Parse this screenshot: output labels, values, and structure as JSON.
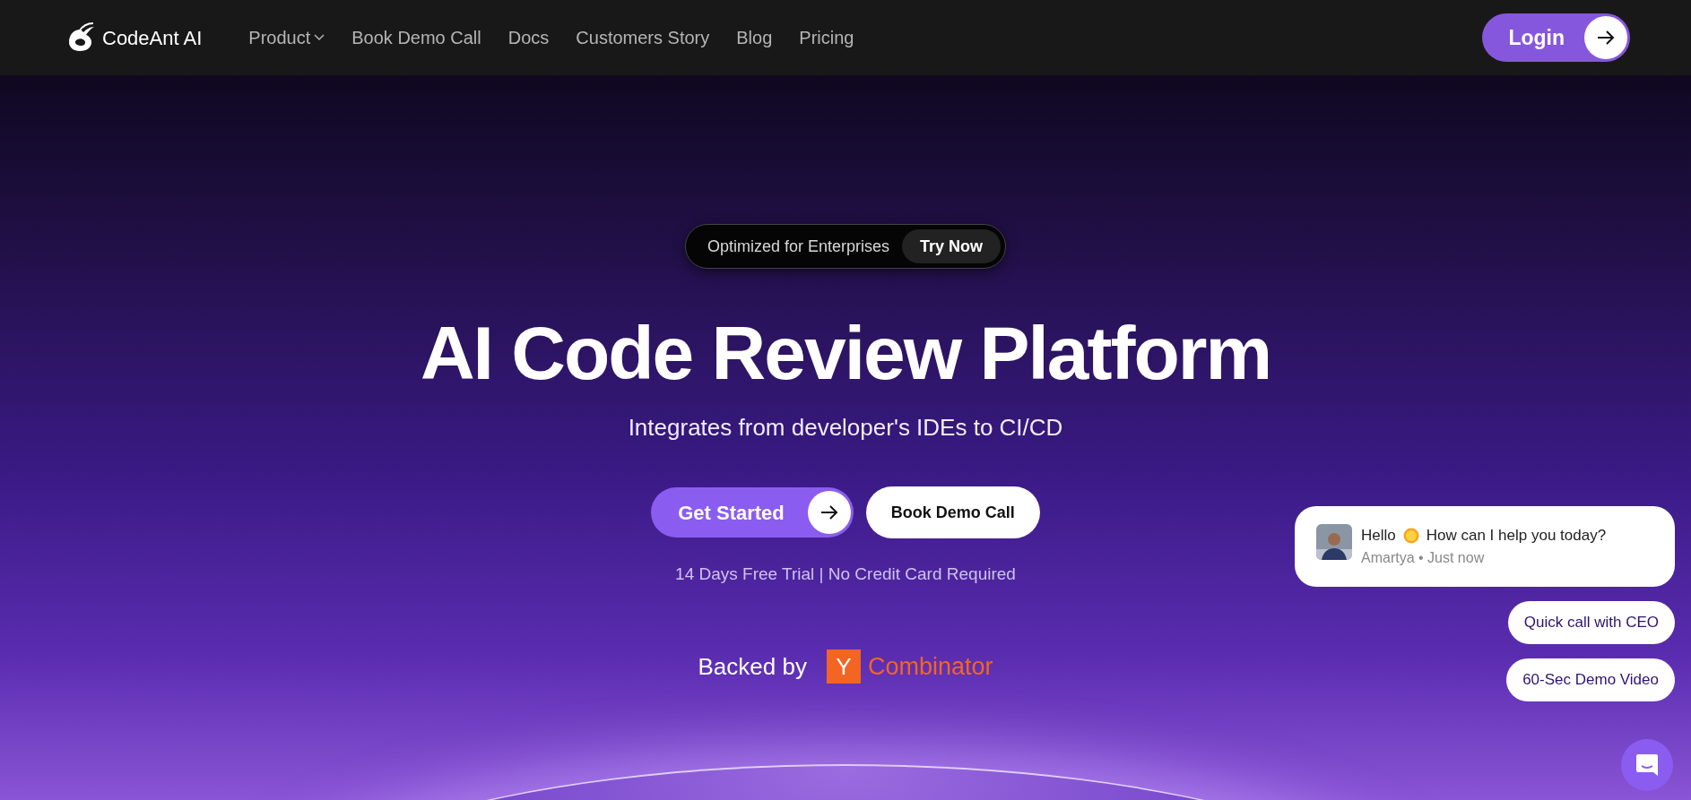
{
  "nav": {
    "brand": "CodeAnt AI",
    "links": [
      {
        "label": "Product",
        "dropdown": true
      },
      {
        "label": "Book Demo Call",
        "dropdown": false
      },
      {
        "label": "Docs",
        "dropdown": false
      },
      {
        "label": "Customers Story",
        "dropdown": false
      },
      {
        "label": "Blog",
        "dropdown": false
      },
      {
        "label": "Pricing",
        "dropdown": false
      }
    ],
    "login": "Login"
  },
  "hero": {
    "badge": {
      "text": "Optimized for Enterprises",
      "action": "Try Now"
    },
    "title": "AI Code Review Platform",
    "subtitle": "Integrates from developer's IDEs to CI/CD",
    "buttons": [
      {
        "label": "Get Started",
        "kind": "primary"
      },
      {
        "label": "Book Demo Call",
        "kind": "secondary"
      }
    ],
    "note": "14 Days Free Trial | No Credit Card Required",
    "backed_by": "Backed by",
    "yc": {
      "letter": "Y",
      "name": "Combinator"
    }
  },
  "chat": {
    "message": {
      "greeting": "Hello",
      "text": "How can I help you today?",
      "meta": "Amartya • Just now"
    },
    "quick_replies": [
      "Quick call with CEO",
      "60-Sec Demo Video"
    ]
  }
}
